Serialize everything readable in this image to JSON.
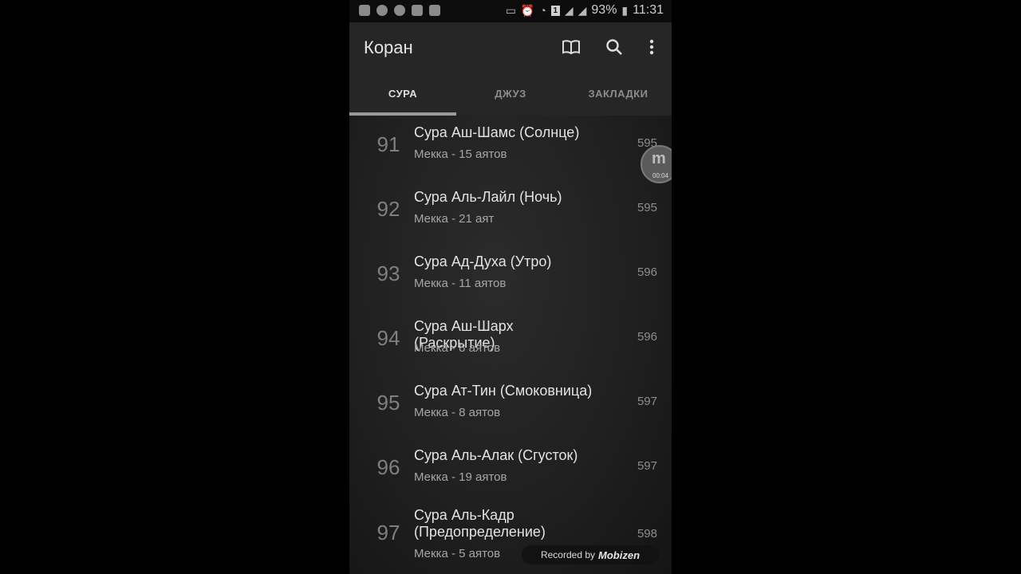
{
  "status_bar": {
    "battery": "93%",
    "time": "11:31",
    "sim_badge": "1"
  },
  "app_bar": {
    "title": "Коран",
    "icons": [
      "book-icon",
      "search-icon",
      "more-vert-icon"
    ]
  },
  "tabs": [
    {
      "label": "СУРА",
      "active": true
    },
    {
      "label": "ДЖУЗ",
      "active": false
    },
    {
      "label": "ЗАКЛАДКИ",
      "active": false
    }
  ],
  "surahs": [
    {
      "number": "91",
      "title": "Сура Аш-Шамс (Солнце)",
      "subtitle": "Мекка - 15 аятов",
      "page": "595"
    },
    {
      "number": "92",
      "title": "Сура Аль-Лайл (Ночь)",
      "subtitle": "Мекка - 21 аят",
      "page": "595"
    },
    {
      "number": "93",
      "title": "Сура Ад-Духа (Утро)",
      "subtitle": "Мекка - 11 аятов",
      "page": "596"
    },
    {
      "number": "94",
      "title": "Сура Аш-Шарх (Раскрытие)",
      "subtitle": "Мекка - 8 аятов",
      "page": "596"
    },
    {
      "number": "95",
      "title": "Сура Ат-Тин (Смоковница)",
      "subtitle": "Мекка - 8 аятов",
      "page": "597"
    },
    {
      "number": "96",
      "title": "Сура Аль-Алак (Сгусток)",
      "subtitle": "Мекка - 19 аятов",
      "page": "597"
    },
    {
      "number": "97",
      "title": "Сура Аль-Кадр (Предопределение)",
      "subtitle": "Мекка - 5 аятов",
      "page": "598"
    }
  ],
  "overlay": {
    "recorder_timer": "00:04",
    "recorder_letter": "m",
    "watermark_text": "Recorded by",
    "watermark_logo": "Mobizen"
  }
}
